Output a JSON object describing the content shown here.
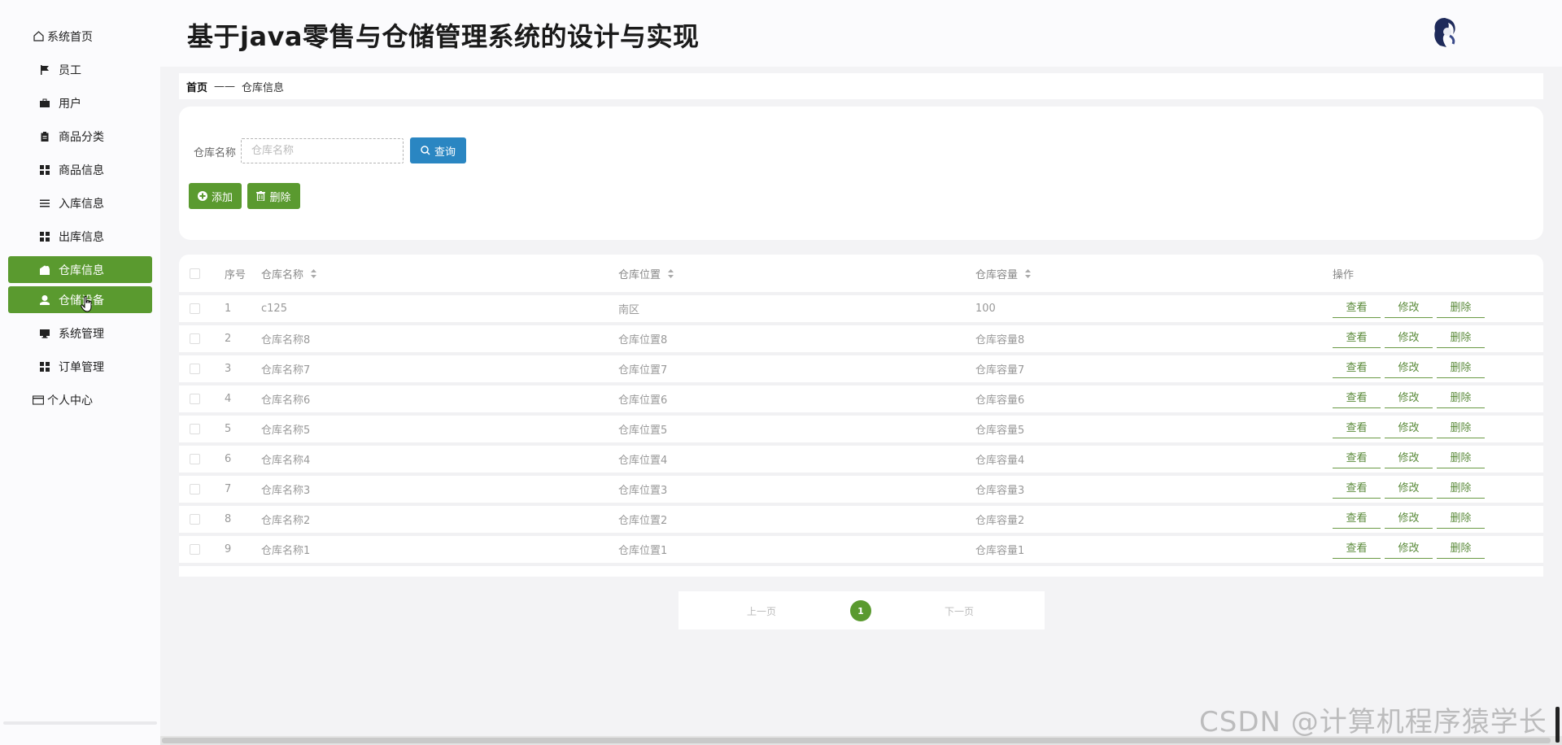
{
  "app": {
    "title": "基于java零售与仓储管理系统的设计与实现"
  },
  "sidebar": {
    "items": [
      {
        "label": "系统首页",
        "icon": "home-icon",
        "level": "top"
      },
      {
        "label": "员工",
        "icon": "flag-icon",
        "level": "sub"
      },
      {
        "label": "用户",
        "icon": "briefcase-icon",
        "level": "sub"
      },
      {
        "label": "商品分类",
        "icon": "clipboard-icon",
        "level": "sub"
      },
      {
        "label": "商品信息",
        "icon": "grid-icon",
        "level": "sub"
      },
      {
        "label": "入库信息",
        "icon": "list-icon",
        "level": "sub"
      },
      {
        "label": "出库信息",
        "icon": "grid-icon",
        "level": "sub"
      },
      {
        "label": "仓库信息",
        "icon": "warehouse-icon",
        "level": "sub",
        "active": true
      },
      {
        "label": "仓储设备",
        "icon": "person-icon",
        "level": "sub",
        "active": true
      },
      {
        "label": "系统管理",
        "icon": "monitor-icon",
        "level": "sub"
      },
      {
        "label": "订单管理",
        "icon": "grid-icon",
        "level": "sub"
      },
      {
        "label": "个人中心",
        "icon": "card-icon",
        "level": "top"
      }
    ]
  },
  "breadcrumb": {
    "home": "首页",
    "separator": "——",
    "current": "仓库信息"
  },
  "search": {
    "label": "仓库名称",
    "placeholder": "仓库名称",
    "query_label": "查询",
    "add_label": "添加",
    "delete_label": "删除"
  },
  "table": {
    "headers": {
      "no": "序号",
      "name": "仓库名称",
      "location": "仓库位置",
      "capacity": "仓库容量",
      "ops": "操作"
    },
    "op_labels": {
      "view": "查看",
      "edit": "修改",
      "delete": "删除"
    },
    "rows": [
      {
        "no": "1",
        "name": "c125",
        "location": "南区",
        "capacity": "100"
      },
      {
        "no": "2",
        "name": "仓库名称8",
        "location": "仓库位置8",
        "capacity": "仓库容量8"
      },
      {
        "no": "3",
        "name": "仓库名称7",
        "location": "仓库位置7",
        "capacity": "仓库容量7"
      },
      {
        "no": "4",
        "name": "仓库名称6",
        "location": "仓库位置6",
        "capacity": "仓库容量6"
      },
      {
        "no": "5",
        "name": "仓库名称5",
        "location": "仓库位置5",
        "capacity": "仓库容量5"
      },
      {
        "no": "6",
        "name": "仓库名称4",
        "location": "仓库位置4",
        "capacity": "仓库容量4"
      },
      {
        "no": "7",
        "name": "仓库名称3",
        "location": "仓库位置3",
        "capacity": "仓库容量3"
      },
      {
        "no": "8",
        "name": "仓库名称2",
        "location": "仓库位置2",
        "capacity": "仓库容量2"
      },
      {
        "no": "9",
        "name": "仓库名称1",
        "location": "仓库位置1",
        "capacity": "仓库容量1"
      }
    ]
  },
  "pagination": {
    "prev": "上一页",
    "current_page": "1",
    "next": "下一页"
  },
  "watermark": "CSDN @计算机程序猿学长",
  "colors": {
    "accent_green": "#5a9a2f",
    "query_blue": "#2a86c2"
  }
}
